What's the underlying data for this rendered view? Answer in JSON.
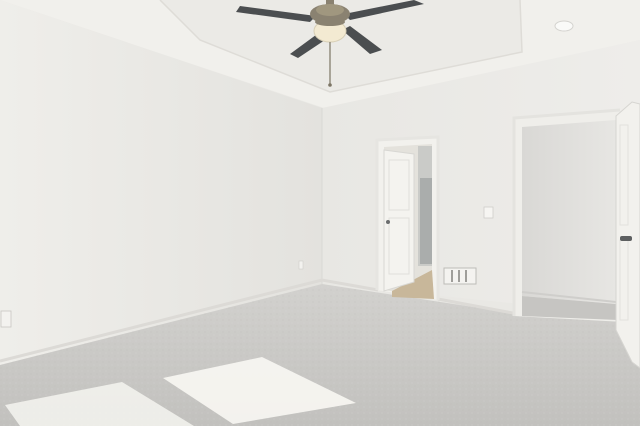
{
  "scene": {
    "description_visible_text": "",
    "colors": {
      "ceiling": "#f1f0ec",
      "tray_ceiling": "#ebeae6",
      "left_wall": "#eceae6",
      "back_wall": "#e6e5e1",
      "right_wall": "#ebeae7",
      "carpet": "#c9c8c5",
      "carpet_light": "#d6d5d2",
      "sunlight": "#f7f6f2",
      "door_white": "#f4f3ef",
      "closet_interior": "#dedddb",
      "bathroom_floor": "#c8b79a",
      "baseboard": "#dcdad6",
      "fan_blade": "#4b4e50",
      "fan_metal": "#8a8271",
      "fan_light": "#f3ead2",
      "vent": "#bdbcb8"
    }
  }
}
